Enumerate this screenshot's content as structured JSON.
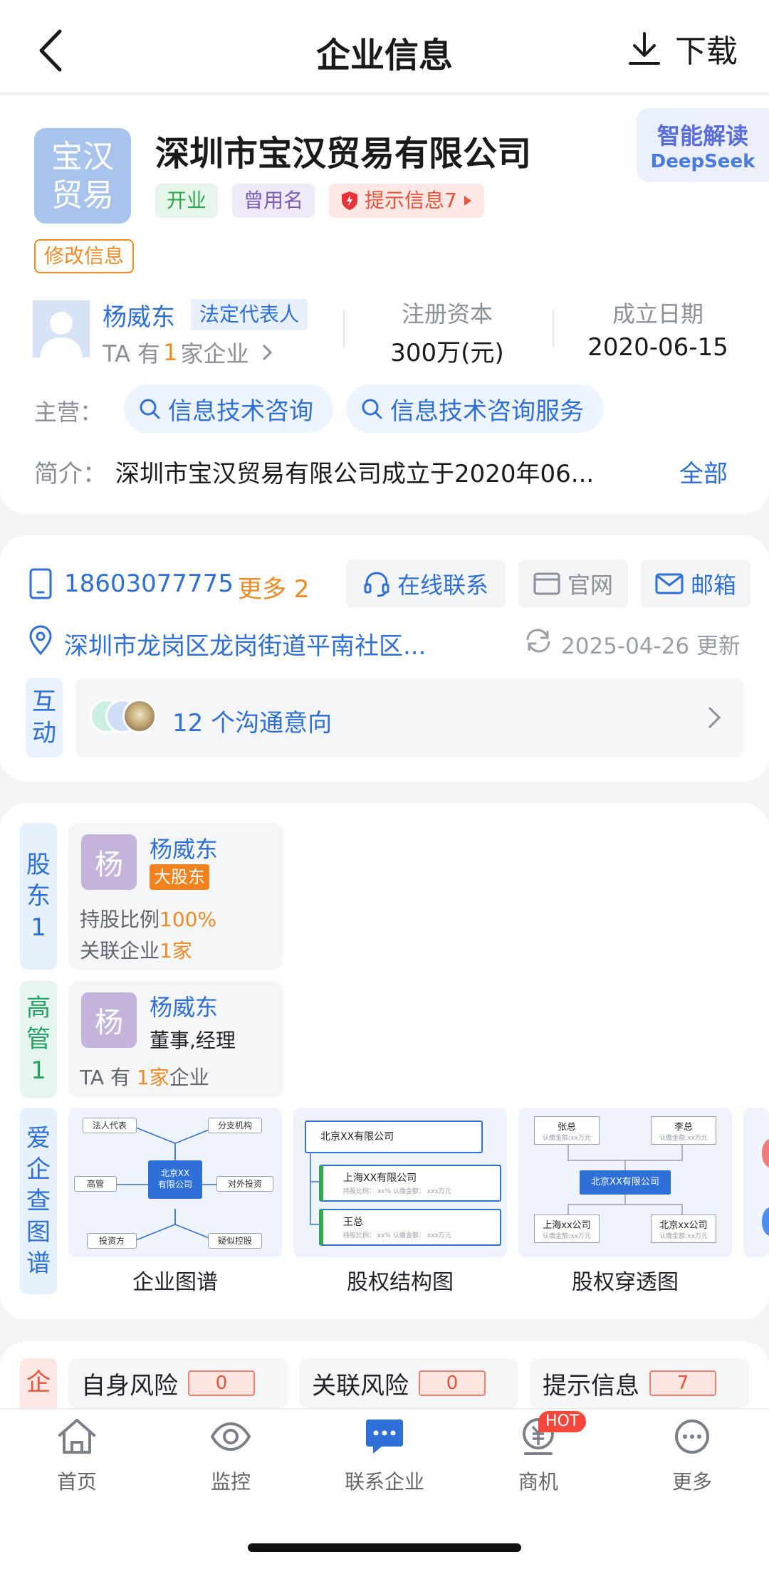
{
  "header": {
    "title": "企业信息",
    "download_label": "下载"
  },
  "company": {
    "logo_line1": "宝汉",
    "logo_line2": "贸易",
    "name": "深圳市宝汉贸易有限公司",
    "status_tag": "开业",
    "former_name_tag": "曾用名",
    "hint_tag": "提示信息7",
    "edit_label": "修改信息",
    "ai_title": "智能解读",
    "ai_sub": "DeepSeek",
    "legal_rep_name": "杨威东",
    "legal_rep_tag": "法定代表人",
    "legal_rep_prefix": "TA 有",
    "legal_rep_count": "1",
    "legal_rep_suffix": "家企业",
    "capital_label": "注册资本",
    "capital_value": "300万(元)",
    "date_label": "成立日期",
    "date_value": "2020-06-15",
    "business_label": "主营：",
    "business_tags": [
      "信息技术咨询",
      "信息技术咨询服务"
    ],
    "intro_label": "简介：",
    "intro_text": "深圳市宝汉贸易有限公司成立于2020年06...",
    "intro_more": "全部"
  },
  "contact": {
    "phone": "18603077775",
    "more": "更多 2",
    "online": "在线联系",
    "website": "官网",
    "email": "邮箱",
    "address": "深圳市龙岗区龙岗街道平南社区...",
    "updated": "2025-04-26 更新",
    "interact_tab": "互动",
    "interact_text": "12 个沟通意向"
  },
  "shareholders": {
    "tab": "股东1",
    "avatar": "杨",
    "name": "杨威东",
    "badge": "大股东",
    "ratio_label": "持股比例",
    "ratio_value": "100%",
    "related_label": "关联企业",
    "related_value": "1家"
  },
  "executives": {
    "tab": "高管1",
    "avatar": "杨",
    "name": "杨威东",
    "role": "董事,经理",
    "prefix": "TA 有",
    "count": "1家",
    "suffix": "企业"
  },
  "graph": {
    "tab": "爱企查图谱",
    "items": [
      {
        "label": "企业图谱"
      },
      {
        "label": "股权结构图"
      },
      {
        "label": "股权穿透图"
      }
    ],
    "g1": {
      "center1": "北京XX",
      "center2": "有限公司",
      "n1": "法人代表",
      "n2": "分支机构",
      "n3": "高管",
      "n4": "对外投资",
      "n5": "投资方",
      "n6": "疑似控股"
    },
    "g2": {
      "top": "北京XX有限公司",
      "sub1": "上海XX有限公司",
      "sub1_line": "持股比例： xx%      认缴金额： xxx万元",
      "sub2": "王总",
      "sub2_line": "持股比例： xx%      认缴金额： xxx万元"
    },
    "g3": {
      "a": "张总",
      "a_sub": "认缴金额:xx万元",
      "b": "李总",
      "b_sub": "认缴金额:xx万元",
      "center": "北京XX有限公司",
      "c": "上海xx公司",
      "c_sub": "认缴金额:xx万元",
      "d": "北京xx公司",
      "d_sub": "认缴金额:xx万元"
    }
  },
  "risk": {
    "tab": "企",
    "self_label": "自身风险",
    "self_value": "0",
    "related_label": "关联风险",
    "related_value": "0",
    "hint_label": "提示信息",
    "hint_value": "7"
  },
  "nav": {
    "home": "首页",
    "monitor": "监控",
    "contact": "联系企业",
    "biz": "商机",
    "biz_badge": "HOT",
    "more": "更多"
  },
  "colors": {
    "accent": "#2e6fd8",
    "orange": "#f08a24",
    "green": "#2fa84f",
    "purple": "#7b5cb8",
    "red": "#e8533b"
  }
}
